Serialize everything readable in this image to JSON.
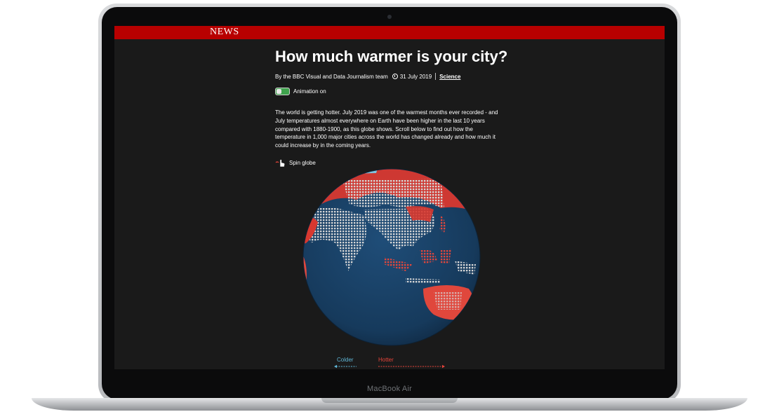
{
  "device": {
    "model_label": "MacBook Air"
  },
  "header": {
    "brand": "NEWS"
  },
  "article": {
    "title": "How much warmer is your city?",
    "author": "By the BBC Visual and Data Journalism team",
    "date": "31 July 2019",
    "topic": "Science",
    "intro": "The world is getting hotter. July 2019 was one of the warmest months ever recorded - and July temperatures almost everywhere on Earth have been higher in the last 10 years compared with 1880-1900, as this globe shows. Scroll below to find out how the temperature in 1,000 major cities across the world has changed already and how much it could increase by in the coming years."
  },
  "controls": {
    "animation_label": "Animation on",
    "animation_on": true,
    "spin_label": "Spin globe"
  },
  "legend": {
    "colder_label": "Colder",
    "hotter_label": "Hotter",
    "colder_color": "#5fb6d6",
    "hotter_color": "#e8443a"
  },
  "colors": {
    "news_red": "#b80000",
    "screen_bg": "#1a1a1a",
    "ocean": "#173b5e",
    "land_warm": "#c9c9c9",
    "toggle_green": "#3fa34d"
  },
  "icons": {
    "clock": "clock-icon",
    "hand": "hand-pointer-icon"
  }
}
